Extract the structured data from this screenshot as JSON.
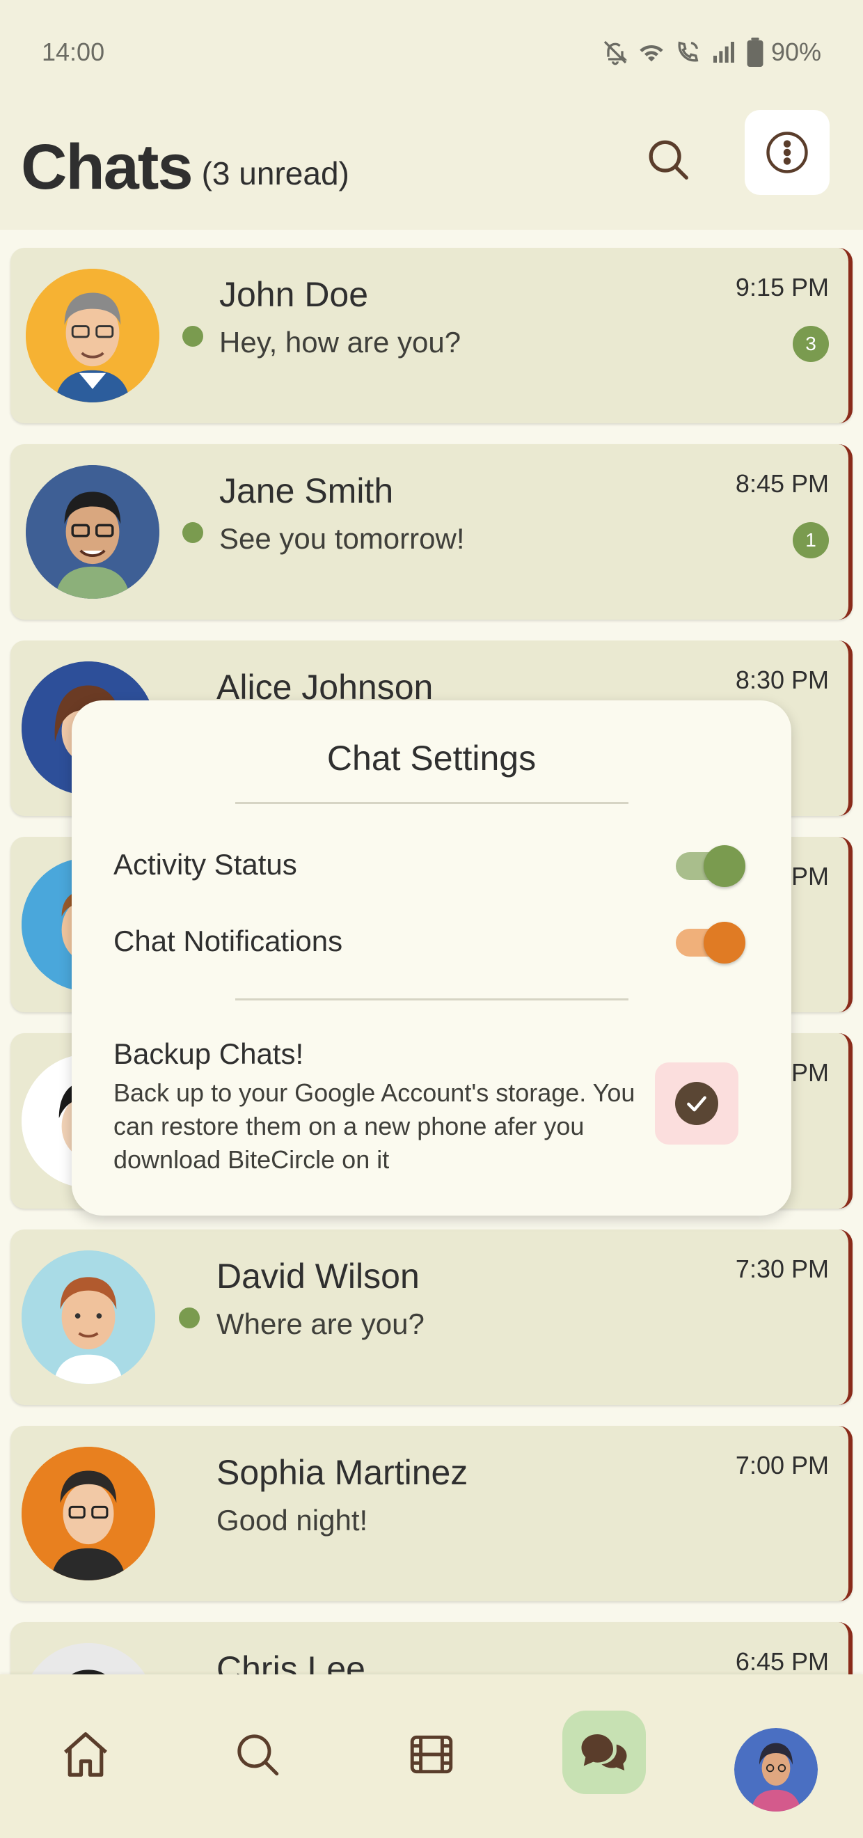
{
  "status_bar": {
    "time": "14:00",
    "battery": "90%",
    "icons": [
      "bell-off-icon",
      "wifi-icon",
      "wifi-call-icon",
      "signal-icon",
      "battery-icon"
    ]
  },
  "header": {
    "title": "Chats",
    "unread": "(3 unread)",
    "icons": [
      "search-icon",
      "more-vertical-icon"
    ]
  },
  "chats": [
    {
      "name": "John Doe",
      "message": "Hey, how are you?",
      "time": "9:15 PM",
      "unread": "3",
      "online": true
    },
    {
      "name": "Jane Smith",
      "message": "See you tomorrow!",
      "time": "8:45 PM",
      "unread": "1",
      "online": true
    },
    {
      "name": "Alice Johnson",
      "message": "",
      "time": "8:30 PM",
      "unread": "",
      "online": false
    },
    {
      "name": "",
      "message": "",
      "time": "PM",
      "unread": "",
      "online": false
    },
    {
      "name": "",
      "message": "",
      "time": "PM",
      "unread": "",
      "online": false
    },
    {
      "name": "David Wilson",
      "message": "Where are you?",
      "time": "7:30 PM",
      "unread": "",
      "online": true
    },
    {
      "name": "Sophia Martinez",
      "message": "Good night!",
      "time": "7:00 PM",
      "unread": "",
      "online": false
    },
    {
      "name": "Chris Lee",
      "message": "",
      "time": "6:45 PM",
      "unread": "",
      "online": false
    }
  ],
  "settings_dialog": {
    "title": "Chat Settings",
    "activity_status_label": "Activity Status",
    "activity_status_on": true,
    "chat_notifications_label": "Chat Notifications",
    "chat_notifications_on": true,
    "backup_title": "Backup Chats!",
    "backup_description": "Back up to your Google Account's storage. You can restore them on a new phone afer you download BiteCircle on it",
    "backup_checked": true
  },
  "bottom_nav": {
    "items": [
      "home-icon",
      "search-icon",
      "film-icon",
      "chat-icon",
      "profile-avatar"
    ],
    "active": "chat-icon"
  },
  "colors": {
    "background": "#f2f0dd",
    "card": "#eae9d1",
    "accent_green": "#7a9b4f",
    "accent_orange": "#e07b24",
    "card_edge": "#8a2b1a",
    "nav_active": "#c7e1b3"
  }
}
